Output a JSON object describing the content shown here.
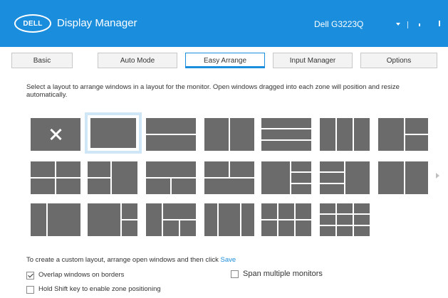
{
  "titlebar": {
    "logo_text": "DELL",
    "app_title": "Display Manager",
    "monitor_name": "Dell G3223Q"
  },
  "tabs": [
    {
      "label": "Basic",
      "active": false
    },
    {
      "label": "Auto Mode",
      "active": false
    },
    {
      "label": "Easy Arrange",
      "active": true
    },
    {
      "label": "Input Manager",
      "active": false
    },
    {
      "label": "Options",
      "active": false
    }
  ],
  "instruction": "Select a layout to arrange windows in a layout for the monitor. Open windows dragged into each zone will position and resize automatically.",
  "layouts": {
    "selected_index": 1,
    "count": 21
  },
  "save_line": {
    "text": "To create a custom layout, arrange open windows and then click",
    "link": "Save"
  },
  "options": {
    "overlap": {
      "label": "Overlap windows on borders",
      "checked": true
    },
    "span": {
      "label": "Span multiple monitors",
      "checked": false
    },
    "shift": {
      "label": "Hold Shift key to enable zone positioning",
      "checked": false
    }
  },
  "colors": {
    "accent": "#1a8ddc",
    "zone": "#6b6b6b",
    "selected_outline": "#cfe6f7"
  }
}
